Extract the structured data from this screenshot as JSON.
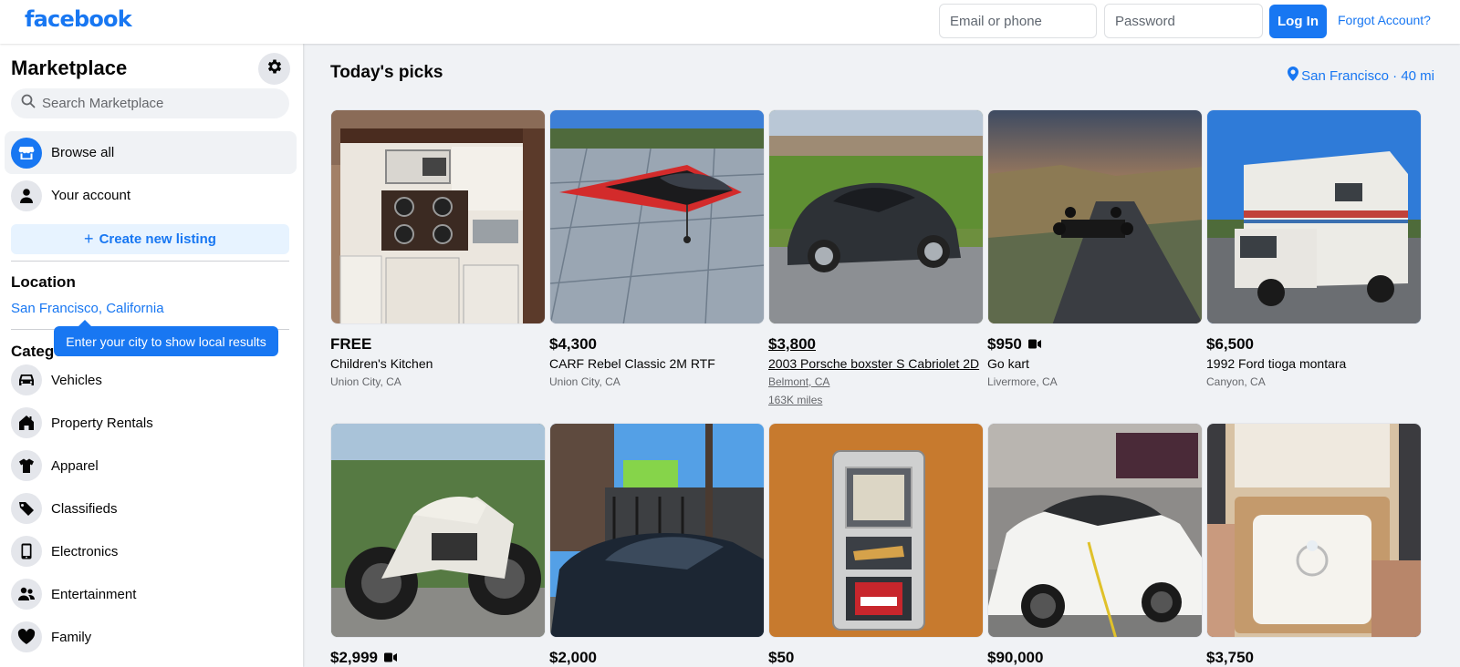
{
  "header": {
    "logo": "facebook",
    "email_placeholder": "Email or phone",
    "password_placeholder": "Password",
    "login_label": "Log In",
    "forgot_label": "Forgot Account?"
  },
  "sidebar": {
    "title": "Marketplace",
    "search_placeholder": "Search Marketplace",
    "nav": [
      {
        "label": "Browse all",
        "icon": "storefront-icon"
      },
      {
        "label": "Your account",
        "icon": "person-icon"
      }
    ],
    "create_label": "Create new listing",
    "location_heading": "Location",
    "location_value": "San Francisco, California",
    "tooltip": "Enter your city to show local results",
    "categories_heading": "Categories",
    "categories": [
      {
        "label": "Vehicles",
        "icon": "car-icon"
      },
      {
        "label": "Property Rentals",
        "icon": "house-icon"
      },
      {
        "label": "Apparel",
        "icon": "shirt-icon"
      },
      {
        "label": "Classifieds",
        "icon": "tag-icon"
      },
      {
        "label": "Electronics",
        "icon": "phone-icon"
      },
      {
        "label": "Entertainment",
        "icon": "people-icon"
      },
      {
        "label": "Family",
        "icon": "heart-icon"
      }
    ]
  },
  "main": {
    "title": "Today's picks",
    "location_chip": "San Francisco · 40 mi",
    "listings": [
      {
        "price": "FREE",
        "title": "Children's Kitchen",
        "location": "Union City, CA"
      },
      {
        "price": "$4,300",
        "title": "CARF Rebel Classic 2M RTF",
        "location": "Union City, CA"
      },
      {
        "price": "$3,800",
        "title": "2003 Porsche boxster S Cabriolet 2D",
        "location": "Belmont, CA",
        "miles": "163K miles"
      },
      {
        "price": "$950",
        "title": "Go kart",
        "location": "Livermore, CA",
        "video": true
      },
      {
        "price": "$6,500",
        "title": "1992 Ford tioga montara",
        "location": "Canyon, CA"
      },
      {
        "price": "$2,999",
        "title": "",
        "location": "",
        "video": true
      },
      {
        "price": "$2,000",
        "title": "",
        "location": ""
      },
      {
        "price": "$50",
        "title": "",
        "location": ""
      },
      {
        "price": "$90,000",
        "title": "",
        "location": ""
      },
      {
        "price": "$3,750",
        "title": "",
        "location": ""
      }
    ]
  },
  "colors": {
    "brand": "#1877f2",
    "background": "#f0f2f5",
    "secondary_text": "#65676b"
  }
}
